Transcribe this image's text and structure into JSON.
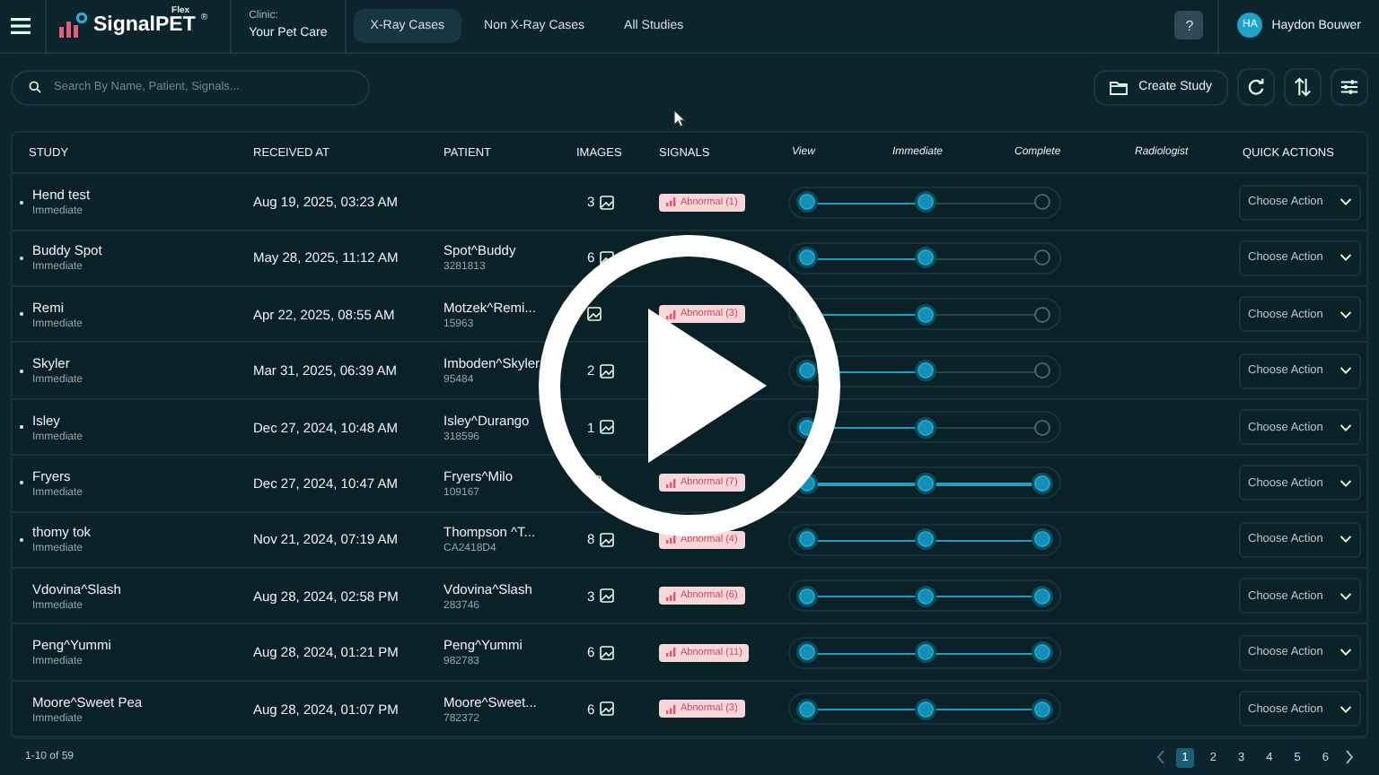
{
  "header": {
    "logo": {
      "name": "SignalPET",
      "edition": "Flex",
      "mark": "®"
    },
    "clinic": {
      "label": "Clinic:",
      "value": "Your Pet Care"
    },
    "tabs": [
      {
        "label": "X-Ray Cases",
        "selected": true
      },
      {
        "label": "Non X-Ray Cases",
        "selected": false
      },
      {
        "label": "All Studies",
        "selected": false
      }
    ],
    "help": "?",
    "user": {
      "initials": "HA",
      "name": "Haydon Bouwer"
    }
  },
  "toolbar": {
    "search": {
      "placeholder": "Search By Name, Patient, Signals..."
    },
    "create_button": "Create Study"
  },
  "table": {
    "columns": [
      "STUDY",
      "RECEIVED AT",
      "PATIENT",
      "IMAGES",
      "SIGNALS",
      "View",
      "Immediate",
      "Complete",
      "Radiologist",
      "QUICK ACTIONS"
    ],
    "rows": [
      {
        "unread": true,
        "study": "Hend test",
        "priority": "Immediate",
        "received": "Aug 19, 2025, 03:23 AM",
        "images": "3",
        "signals": "Abnormal (1)",
        "steps": [
          {
            "done": true
          },
          {
            "done": true
          },
          {
            "done": false
          }
        ],
        "action": "Choose Action"
      },
      {
        "unread": true,
        "study": "Buddy Spot",
        "priority": "Immediate",
        "received": "May 28, 2025, 11:12 AM",
        "patient": "Spot^Buddy",
        "patient_id": "3281813",
        "images": "6",
        "steps": [
          {
            "done": true
          },
          {
            "done": true
          },
          {
            "done": false
          }
        ],
        "action": "Choose Action"
      },
      {
        "unread": true,
        "study": "Remi",
        "priority": "Immediate",
        "received": "Apr 22, 2025, 08:55 AM",
        "patient": "Motzek^Remi...",
        "patient_id": "15963",
        "signals": "Abnormal (3)",
        "steps": [
          {
            "done": true
          },
          {
            "done": true
          },
          {
            "done": false
          }
        ],
        "action": "Choose Action"
      },
      {
        "unread": true,
        "study": "Skyler",
        "priority": "Immediate",
        "received": "Mar 31, 2025, 06:39 AM",
        "patient": "Imboden^Skyler",
        "patient_id": "95484",
        "images": "2",
        "steps": [
          {
            "done": true
          },
          {
            "done": true
          },
          {
            "done": false
          }
        ],
        "action": "Choose Action"
      },
      {
        "unread": true,
        "study": "Isley",
        "priority": "Immediate",
        "received": "Dec 27, 2024, 10:48 AM",
        "patient": "Isley^Durango",
        "patient_id": "318596",
        "images": "1",
        "steps": [
          {
            "done": true
          },
          {
            "done": true
          },
          {
            "done": false
          }
        ],
        "action": "Choose Action"
      },
      {
        "unread": true,
        "study": "Fryers",
        "priority": "Immediate",
        "received": "Dec 27, 2024, 10:47 AM",
        "patient": "Fryers^Milo",
        "patient_id": "109167",
        "signals": "Abnormal (7)",
        "steps": [
          {
            "done": true
          },
          {
            "done": true
          },
          {
            "done": true
          }
        ],
        "action": "Choose Action"
      },
      {
        "unread": true,
        "study": "thomy tok",
        "priority": "Immediate",
        "received": "Nov 21, 2024, 07:19 AM",
        "patient": "Thompson ^T...",
        "patient_id": "CA2418D4",
        "images": "8",
        "signals": "Abnormal (4)",
        "steps": [
          {
            "done": true
          },
          {
            "done": true
          },
          {
            "done": true
          }
        ],
        "action": "Choose Action"
      },
      {
        "unread": false,
        "study": "Vdovina^Slash",
        "priority": "Immediate",
        "received": "Aug 28, 2024, 02:58 PM",
        "patient": "Vdovina^Slash",
        "patient_id": "283746",
        "images": "3",
        "signals": "Abnormal (6)",
        "steps": [
          {
            "done": true
          },
          {
            "done": true
          },
          {
            "done": true
          }
        ],
        "action": "Choose Action"
      },
      {
        "unread": false,
        "study": "Peng^Yummi",
        "priority": "Immediate",
        "received": "Aug 28, 2024, 01:21 PM",
        "patient": "Peng^Yummi",
        "patient_id": "982783",
        "images": "6",
        "signals": "Abnormal (11)",
        "steps": [
          {
            "done": true
          },
          {
            "done": true
          },
          {
            "done": true
          }
        ],
        "action": "Choose Action"
      },
      {
        "unread": false,
        "study": "Moore^Sweet Pea",
        "priority": "Immediate",
        "received": "Aug 28, 2024, 01:07 PM",
        "patient": "Moore^Sweet...",
        "patient_id": "782372",
        "images": "6",
        "signals": "Abnormal (3)",
        "steps": [
          {
            "done": true
          },
          {
            "done": true
          },
          {
            "done": true
          }
        ],
        "action": "Choose Action"
      }
    ]
  },
  "footer": {
    "range": "1-10 of 59",
    "pages": [
      {
        "label": "1",
        "selected": true
      },
      {
        "label": "2",
        "selected": false
      },
      {
        "label": "3",
        "selected": false
      },
      {
        "label": "4",
        "selected": false
      },
      {
        "label": "5",
        "selected": false
      },
      {
        "label": "6",
        "selected": false
      }
    ]
  }
}
